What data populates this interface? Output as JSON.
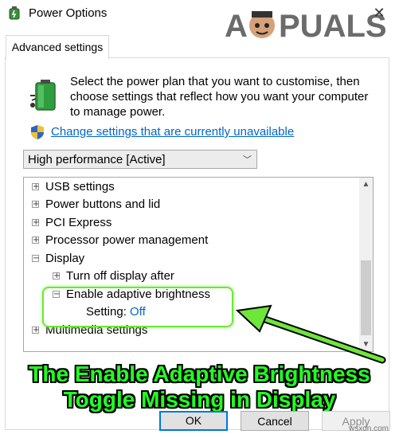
{
  "window": {
    "title": "Power Options",
    "watermark": "APPUALS"
  },
  "tabs": [
    {
      "label": "Advanced settings"
    }
  ],
  "description": "Select the power plan that you want to customise, then choose settings that reflect how you want your computer to manage power.",
  "change_link": "Change settings that are currently unavailable",
  "plan_select": {
    "value": "High performance [Active]"
  },
  "tree": [
    {
      "label": "USB settings",
      "expander": "+"
    },
    {
      "label": "Power buttons and lid",
      "expander": "+"
    },
    {
      "label": "PCI Express",
      "expander": "+"
    },
    {
      "label": "Processor power management",
      "expander": "+"
    },
    {
      "label": "Display",
      "expander": "−"
    },
    {
      "label": "Turn off display after",
      "expander": "+"
    },
    {
      "label": "Enable adaptive brightness",
      "expander": "−"
    },
    {
      "label": "Setting:",
      "value": "Off"
    },
    {
      "label": "Multimedia settings",
      "expander": "+"
    }
  ],
  "caption": {
    "line1": "The Enable Adaptive Brightness",
    "line2": "Toggle Missing in Display"
  },
  "buttons": {
    "ok": "OK",
    "cancel": "Cancel",
    "apply": "Apply"
  },
  "source": "wsxdn.com",
  "colors": {
    "link": "#0066cc",
    "highlight": "#6ee63a",
    "caption": "#22ff22"
  }
}
